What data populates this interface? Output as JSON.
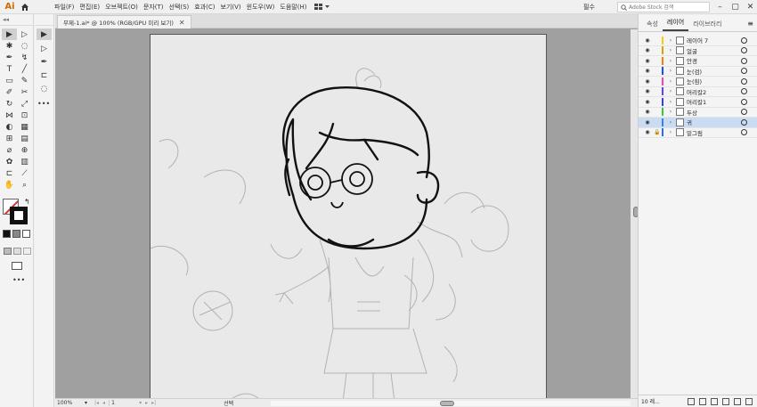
{
  "app": {
    "logo": "Ai",
    "menu": [
      "파일(F)",
      "편집(E)",
      "오브젝트(O)",
      "문자(T)",
      "선택(S)",
      "효과(C)",
      "보기(V)",
      "윈도우(W)",
      "도움말(H)"
    ],
    "workspace": "필수",
    "stock_search_placeholder": "Adobe Stock 검색"
  },
  "document": {
    "tab_title": "무제-1.ai* @ 100% (RGB/GPU 미리 보기)",
    "zoom": "100%",
    "page": "1",
    "status_tool": "선택"
  },
  "panel": {
    "tabs": [
      "속성",
      "레이어",
      "라이브러리"
    ],
    "active_tab": "레이어",
    "layers": [
      {
        "name": "레이어 7",
        "color": "#f5d000",
        "locked": false,
        "selected": false
      },
      {
        "name": "얼굴",
        "color": "#e0a000",
        "locked": false,
        "selected": false
      },
      {
        "name": "안경",
        "color": "#ff7f00",
        "locked": false,
        "selected": false
      },
      {
        "name": "눈(검)",
        "color": "#1f4aff",
        "locked": false,
        "selected": false
      },
      {
        "name": "눈(흰)",
        "color": "#ff3fb0",
        "locked": false,
        "selected": false
      },
      {
        "name": "머리칼2",
        "color": "#6c3cff",
        "locked": false,
        "selected": false
      },
      {
        "name": "머리칼1",
        "color": "#3a3aff",
        "locked": false,
        "selected": false
      },
      {
        "name": "두상",
        "color": "#33cc33",
        "locked": false,
        "selected": false
      },
      {
        "name": "귀",
        "color": "#3a7fff",
        "locked": false,
        "selected": true
      },
      {
        "name": "밑그림",
        "color": "#2a6bff",
        "locked": true,
        "selected": false
      }
    ],
    "layer_count": "10 레..."
  }
}
